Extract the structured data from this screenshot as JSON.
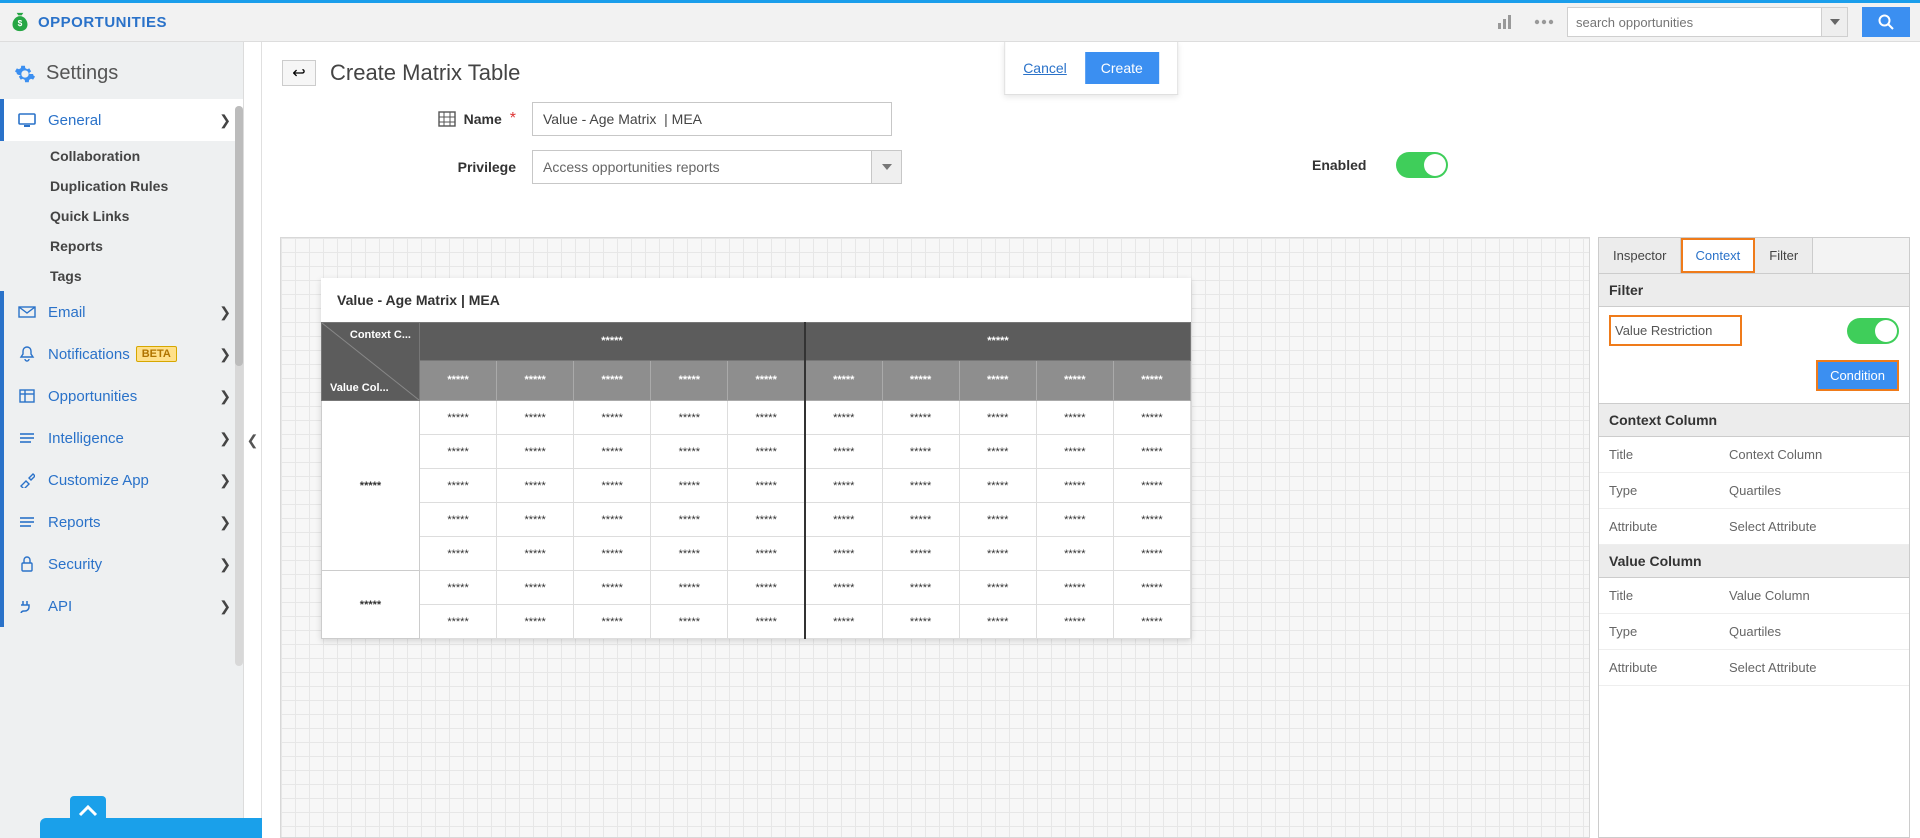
{
  "app": {
    "title": "OPPORTUNITIES",
    "search_placeholder": "search opportunities"
  },
  "floating": {
    "cancel": "Cancel",
    "create": "Create"
  },
  "sidebar": {
    "header": "Settings",
    "items": [
      {
        "label": "General"
      },
      {
        "label": "Collaboration"
      },
      {
        "label": "Duplication Rules"
      },
      {
        "label": "Quick Links"
      },
      {
        "label": "Reports"
      },
      {
        "label": "Tags"
      },
      {
        "label": "Email"
      },
      {
        "label": "Notifications",
        "badge": "BETA"
      },
      {
        "label": "Opportunities"
      },
      {
        "label": "Intelligence"
      },
      {
        "label": "Customize App"
      },
      {
        "label": "Reports"
      },
      {
        "label": "Security"
      },
      {
        "label": "API"
      }
    ]
  },
  "page": {
    "title": "Create Matrix Table",
    "name_label": "Name",
    "name_value": "Value - Age Matrix  | MEA",
    "privilege_label": "Privilege",
    "privilege_value": "Access opportunities reports",
    "enabled_label": "Enabled"
  },
  "matrix": {
    "title": "Value - Age Matrix | MEA",
    "corner_context": "Context C...",
    "corner_value": "Value Col...",
    "placeholder": "*****"
  },
  "panel": {
    "tabs": {
      "inspector": "Inspector",
      "context": "Context",
      "filter": "Filter"
    },
    "filter_hdr": "Filter",
    "value_restriction": "Value Restriction",
    "condition": "Condition",
    "context_col_hdr": "Context Column",
    "value_col_hdr": "Value Column",
    "rows": {
      "title": "Title",
      "type": "Type",
      "attribute": "Attribute",
      "ctx_title_v": "Context Column",
      "ctx_type_v": "Quartiles",
      "ctx_attr_v": "Select Attribute",
      "val_title_v": "Value Column",
      "val_type_v": "Quartiles",
      "val_attr_v": "Select Attribute"
    }
  }
}
